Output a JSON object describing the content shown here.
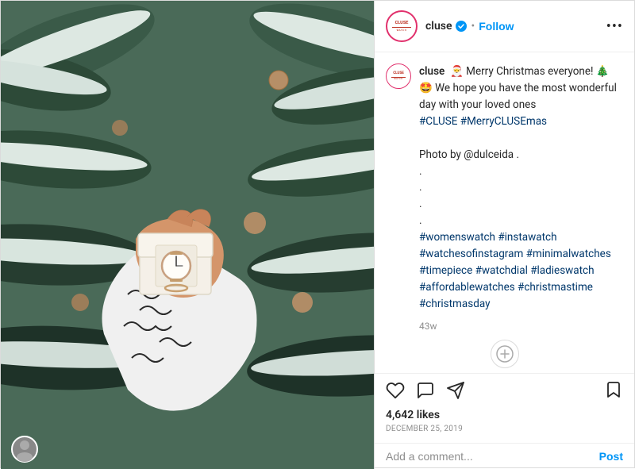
{
  "header": {
    "username": "cluse",
    "follow_label": "Follow",
    "more_label": "•••",
    "avatar_text": "CLUSE"
  },
  "caption": {
    "username": "cluse",
    "text": " 🎅 Merry Christmas everyone! 🎄\n🤩 We hope you have the most wonderful day with your loved ones\n#CLUSE #MerryCLUSEmas\n\nPhoto by @dulceida .\n.\n.\n.\n.",
    "hashtags": "#womenswatch #instawatch\n#watchesofinstagram #minimalwatches\n#timepiece #watchdial #ladieswatch\n#affordablewatches #christmastime\n#christmasday",
    "timestamp": "43w"
  },
  "actions": {
    "likes": "4,642 likes",
    "date": "December 25, 2019",
    "comment_placeholder": "Add a comment...",
    "post_label": "Post"
  },
  "colors": {
    "follow": "#0095f6",
    "verified": "#0095f6",
    "hashtag": "#00376b"
  }
}
